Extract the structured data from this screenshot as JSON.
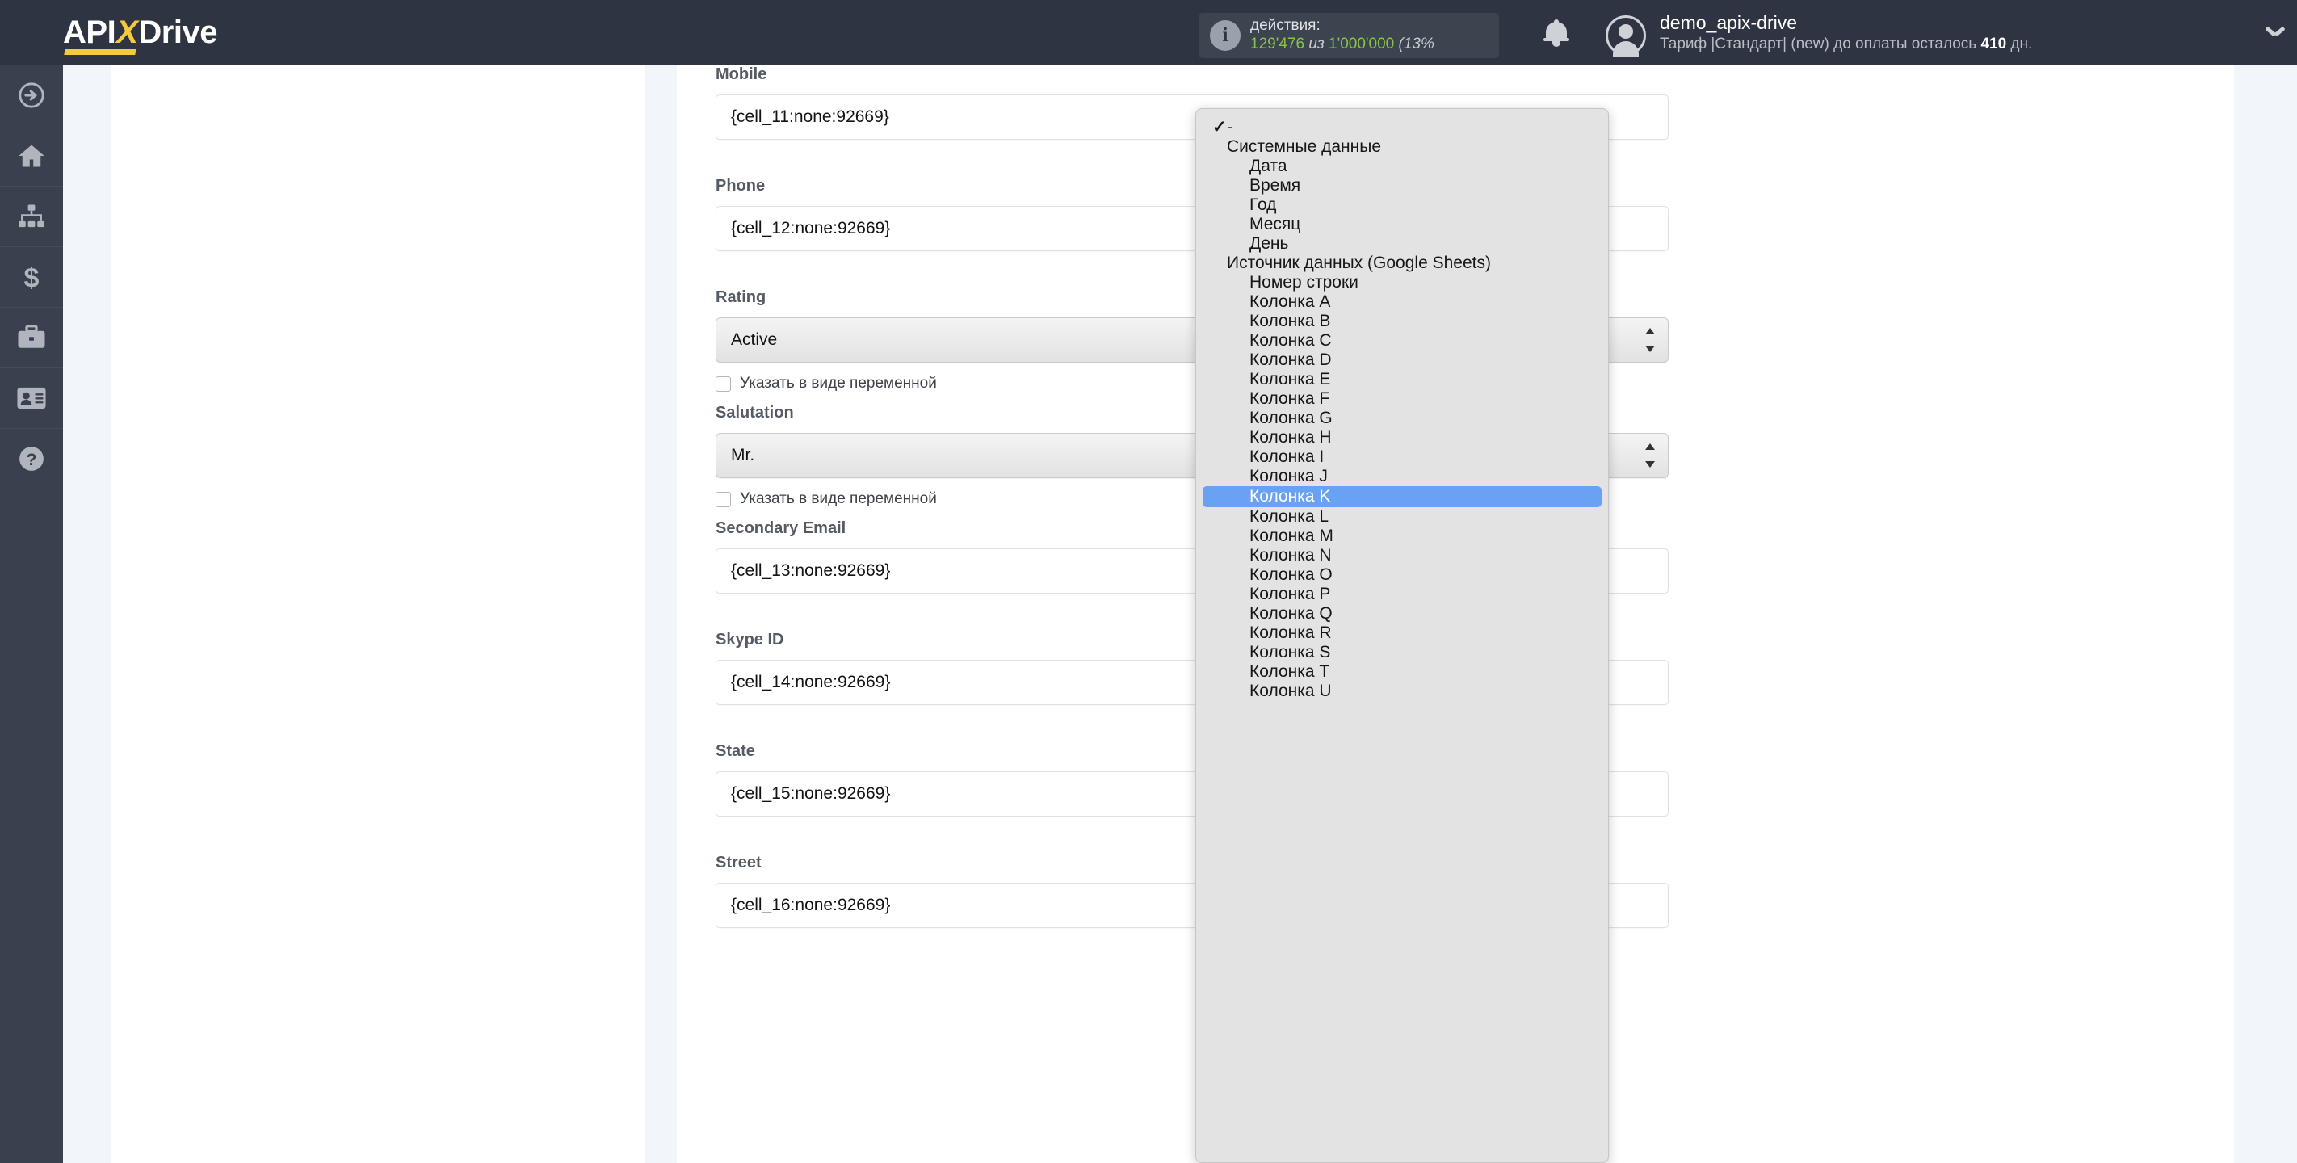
{
  "brand": {
    "name_part1": "API",
    "name_x": "X",
    "name_part2": "Drive"
  },
  "header": {
    "usage": {
      "icon": "info-icon",
      "label": "действия:",
      "used": "129'476",
      "middle": "из",
      "total": "1'000'000",
      "percent": "(13%"
    },
    "bell_icon": "bell-icon",
    "avatar_icon": "user-avatar-icon",
    "account_name": "demo_apix-drive",
    "account_plan_prefix": "Тариф |Стандарт| (new) до оплаты осталось ",
    "account_plan_days": "410",
    "account_plan_suffix": " дн.",
    "chevron_icon": "chevron-down-icon"
  },
  "sidebar": {
    "items": [
      {
        "icon": "arrow-right-circle-icon",
        "name": "sidebar-item-connections"
      },
      {
        "icon": "home-icon",
        "name": "sidebar-item-home"
      },
      {
        "icon": "sitemap-icon",
        "name": "sidebar-item-structure"
      },
      {
        "icon": "dollar-icon",
        "name": "sidebar-item-billing"
      },
      {
        "icon": "briefcase-icon",
        "name": "sidebar-item-business"
      },
      {
        "icon": "id-card-icon",
        "name": "sidebar-item-account"
      },
      {
        "icon": "question-circle-icon",
        "name": "sidebar-item-help"
      }
    ]
  },
  "form": {
    "variable_checkbox_label": "Указать в виде переменной",
    "fields": [
      {
        "label": "Mobile",
        "type": "text",
        "value": "{cell_11:none:92669}"
      },
      {
        "label": "Phone",
        "type": "text",
        "value": "{cell_12:none:92669}"
      },
      {
        "label": "Rating",
        "type": "select",
        "value": "Active"
      },
      {
        "label": "Salutation",
        "type": "select",
        "value": "Mr."
      },
      {
        "label": "Secondary Email",
        "type": "text",
        "value": "{cell_13:none:92669}"
      },
      {
        "label": "Skype ID",
        "type": "text",
        "value": "{cell_14:none:92669}"
      },
      {
        "label": "State",
        "type": "text",
        "value": "{cell_15:none:92669}"
      },
      {
        "label": "Street",
        "type": "text",
        "value": "{cell_16:none:92669}"
      }
    ]
  },
  "dropdown": {
    "selected_label": "Колонка K",
    "items": [
      {
        "label": "-",
        "level": "root",
        "checked": true
      },
      {
        "label": "Системные данные",
        "level": "group"
      },
      {
        "label": "Дата",
        "level": "child"
      },
      {
        "label": "Время",
        "level": "child"
      },
      {
        "label": "Год",
        "level": "child"
      },
      {
        "label": "Месяц",
        "level": "child"
      },
      {
        "label": "День",
        "level": "child"
      },
      {
        "label": "Источник данных (Google Sheets)",
        "level": "group"
      },
      {
        "label": "Номер строки",
        "level": "child"
      },
      {
        "label": "Колонка A",
        "level": "child"
      },
      {
        "label": "Колонка B",
        "level": "child"
      },
      {
        "label": "Колонка C",
        "level": "child"
      },
      {
        "label": "Колонка D",
        "level": "child"
      },
      {
        "label": "Колонка E",
        "level": "child"
      },
      {
        "label": "Колонка F",
        "level": "child"
      },
      {
        "label": "Колонка G",
        "level": "child"
      },
      {
        "label": "Колонка H",
        "level": "child"
      },
      {
        "label": "Колонка I",
        "level": "child"
      },
      {
        "label": "Колонка J",
        "level": "child"
      },
      {
        "label": "Колонка K",
        "level": "child",
        "selected": true
      },
      {
        "label": "Колонка L",
        "level": "child"
      },
      {
        "label": "Колонка M",
        "level": "child"
      },
      {
        "label": "Колонка N",
        "level": "child"
      },
      {
        "label": "Колонка O",
        "level": "child"
      },
      {
        "label": "Колонка P",
        "level": "child"
      },
      {
        "label": "Колонка Q",
        "level": "child"
      },
      {
        "label": "Колонка R",
        "level": "child"
      },
      {
        "label": "Колонка S",
        "level": "child"
      },
      {
        "label": "Колонка T",
        "level": "child"
      },
      {
        "label": "Колонка U",
        "level": "child"
      }
    ]
  },
  "colors": {
    "header_bg": "#2e3441",
    "sidebar_bg": "#39404e",
    "accent_yellow": "#f5cb3e",
    "page_bg": "#f2f5fa",
    "usage_green": "#8bc34a",
    "dropdown_bg": "#e3e3e3",
    "selection_blue": "#6aa2f3"
  }
}
